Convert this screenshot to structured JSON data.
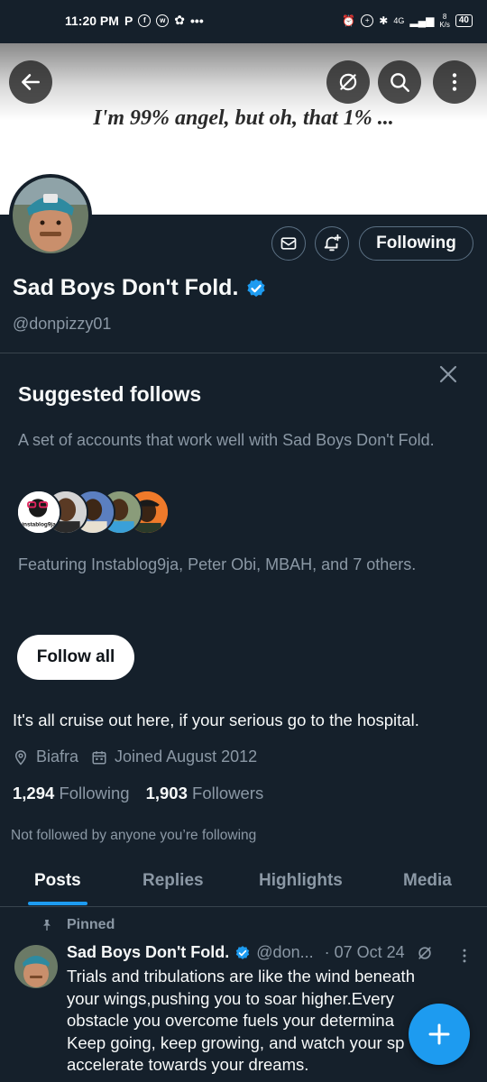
{
  "status_bar": {
    "time": "11:20 PM",
    "left_icons": [
      "p-icon",
      "facebook-icon",
      "whatsapp-icon",
      "app-icon",
      "more-dots"
    ],
    "right_icons": [
      "alarm-icon",
      "data-saver-icon",
      "bluetooth-icon",
      "signal-icon"
    ],
    "network_type": "4G",
    "speed_value": "8",
    "speed_unit": "K/s",
    "battery": "40"
  },
  "header": {
    "banner_text": "I'm 99% angel, but oh, that 1% ...",
    "back_icon": "arrow-left-icon",
    "grok_icon": "grok-icon",
    "search_icon": "search-icon",
    "more_icon": "more-vertical-icon"
  },
  "profile": {
    "display_name": "Sad Boys Don't Fold.",
    "verified": true,
    "handle": "@donpizzy01",
    "following_button": "Following",
    "bio": "It's all cruise out here, if your serious go to the hospital.",
    "location": "Biafra",
    "joined": "Joined August 2012",
    "following_count": "1,294",
    "following_label": "Following",
    "followers_count": "1,903",
    "followers_label": "Followers",
    "not_followed_note": "Not followed by anyone you’re following"
  },
  "suggested": {
    "title": "Suggested follows",
    "description": "A set of accounts that work well with Sad Boys Don't Fold.",
    "featuring": "Featuring Instablog9ja, Peter Obi, MBAH, and 7 others.",
    "follow_all": "Follow all",
    "avatar_label": "instablog9ja"
  },
  "tabs": [
    {
      "label": "Posts",
      "active": true
    },
    {
      "label": "Replies",
      "active": false
    },
    {
      "label": "Highlights",
      "active": false
    },
    {
      "label": "Media",
      "active": false
    }
  ],
  "post": {
    "pinned_label": "Pinned",
    "author": "Sad Boys Don't Fold.",
    "handle": "@don...",
    "date": "· 07 Oct 24",
    "text": "Trials and tribulations are like the wind beneath your wings,pushing you to soar higher.Every obstacle you overcome fuels your determina",
    "text_cont": "Keep going, keep growing, and watch your sp",
    "text_end": "accelerate towards your dreams."
  },
  "colors": {
    "background": "#15202b",
    "accent": "#1d9bf0",
    "muted": "#8b98a5",
    "border": "#38444d"
  }
}
